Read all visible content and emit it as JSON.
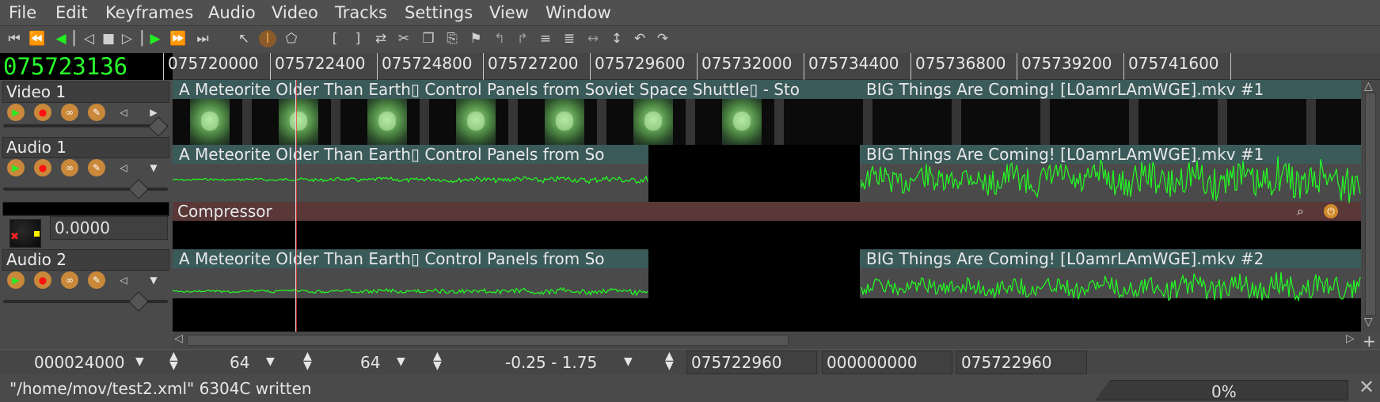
{
  "menu": [
    "File",
    "Edit",
    "Keyframes",
    "Audio",
    "Video",
    "Tracks",
    "Settings",
    "View",
    "Window"
  ],
  "toolbar": {
    "transport_icons": [
      "rewind-to-start-icon",
      "fast-reverse-icon",
      "reverse-play-icon",
      "frame-back-icon",
      "stop-icon",
      "frame-forward-icon",
      "play-icon",
      "fast-forward-icon",
      "skip-to-end-icon"
    ],
    "edit_icons": [
      "arrow-select-icon",
      "ibeam-select-icon",
      "label-icon",
      "in-point-icon",
      "out-point-icon",
      "splice-icon",
      "cut-icon",
      "copy-icon",
      "paste-icon",
      "label-set-icon",
      "label-prev-icon",
      "label-next-icon",
      "fit-selection-icon",
      "fit-autos-icon",
      "expand-icon",
      "shrink-icon",
      "undo-icon",
      "redo-icon"
    ]
  },
  "clock": "075723136",
  "ruler_labels": [
    "075720000",
    "075722400",
    "075724800",
    "075727200",
    "075729600",
    "075732000",
    "075734400",
    "075736800",
    "075739200",
    "075741600"
  ],
  "tracks": [
    {
      "name": "Video 1",
      "type": "video"
    },
    {
      "name": "Audio 1",
      "type": "audio"
    },
    {
      "name": "Audio 2",
      "type": "audio"
    }
  ],
  "plugin_value": "0.0000",
  "edits": {
    "video1_a": "A Meteorite Older Than Earth▯ Control Panels from Soviet Space Shuttle▯ - Sto",
    "video1_b": "BIG Things Are Coming! [L0amrLAmWGE].mkv #1",
    "audio1_a": "A Meteorite Older Than Earth▯ Control Panels from So",
    "audio1_b": "BIG Things Are Coming! [L0amrLAmWGE].mkv #1",
    "audio2_a": "A Meteorite Older Than Earth▯ Control Panels from So",
    "audio2_b": "BIG Things Are Coming! [L0amrLAmWGE].mkv #2"
  },
  "effect_label": "Compressor",
  "zoom": {
    "sample_zoom": "000024000",
    "amp_zoom": "64",
    "track_zoom": "64",
    "curve_zoom": "-0.25 - 1.75",
    "selection_start": "075722960",
    "selection_length": "000000000",
    "selection_end": "075722960"
  },
  "status": {
    "message": "\"/home/mov/test2.xml\" 6304C written",
    "progress": "0%"
  },
  "colors": {
    "waveform": "#22ff22",
    "clock": "#2aff2a",
    "title_bar": "#3b5a5a",
    "effect_bar": "#5a3838",
    "playhead": "#ff3333"
  }
}
